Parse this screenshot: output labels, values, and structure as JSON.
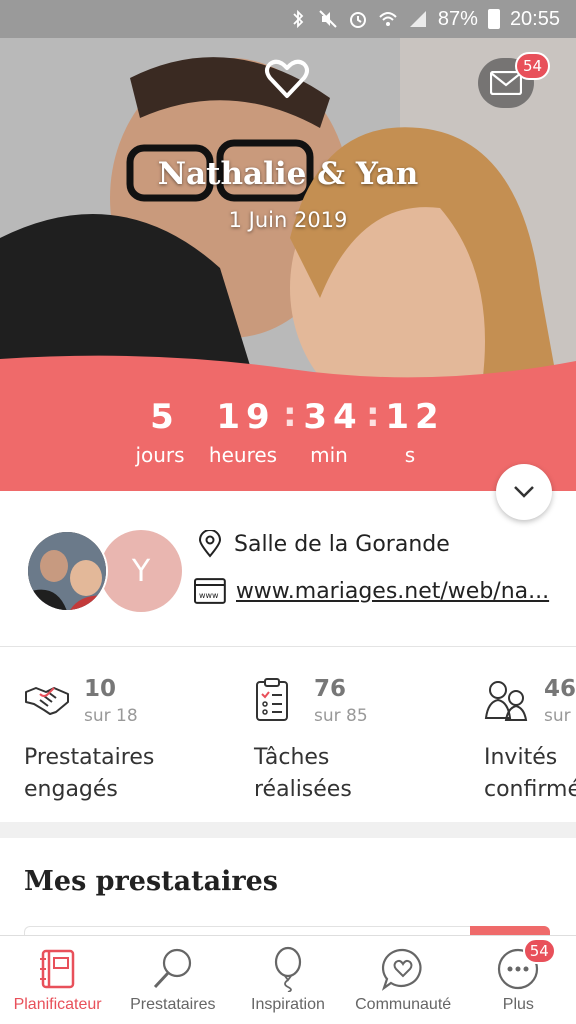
{
  "status_bar": {
    "battery_percent": "87%",
    "time": "20:55"
  },
  "hero": {
    "couple_name": "Nathalie & Yan",
    "wedding_date": "1 Juin 2019",
    "mail_badge_count": "54"
  },
  "countdown": {
    "days": "5",
    "hours": "19",
    "minutes": "34",
    "seconds": "12",
    "separator": ":",
    "labels": {
      "days": "jours",
      "hours": "heures",
      "minutes": "min",
      "seconds": "s"
    }
  },
  "wedding_info": {
    "avatar_initial": "Y",
    "venue": "Salle de la Gorande",
    "website": "www.mariages.net/web/na..."
  },
  "stats": [
    {
      "value": "10",
      "total": "sur 18",
      "label_line1": "Prestataires",
      "label_line2": "engagés",
      "icon": "handshake-icon"
    },
    {
      "value": "76",
      "total": "sur 85",
      "label_line1": "Tâches",
      "label_line2": "réalisées",
      "icon": "checklist-icon"
    },
    {
      "value": "46",
      "total": "sur",
      "label_line1": "Invités",
      "label_line2": "confirmés",
      "icon": "guests-icon"
    }
  ],
  "section": {
    "title": "Mes prestataires"
  },
  "bottom_nav": {
    "items": [
      {
        "label": "Planificateur",
        "icon": "planner-icon",
        "active": true
      },
      {
        "label": "Prestataires",
        "icon": "search-icon",
        "active": false
      },
      {
        "label": "Inspiration",
        "icon": "balloon-icon",
        "active": false
      },
      {
        "label": "Communauté",
        "icon": "chat-heart-icon",
        "active": false
      },
      {
        "label": "Plus",
        "icon": "more-icon",
        "active": false
      }
    ],
    "more_badge_count": "54"
  },
  "colors": {
    "accent": "#ef6a6a",
    "badge": "#e8505a",
    "avatar_bg": "#e9b6b0"
  }
}
